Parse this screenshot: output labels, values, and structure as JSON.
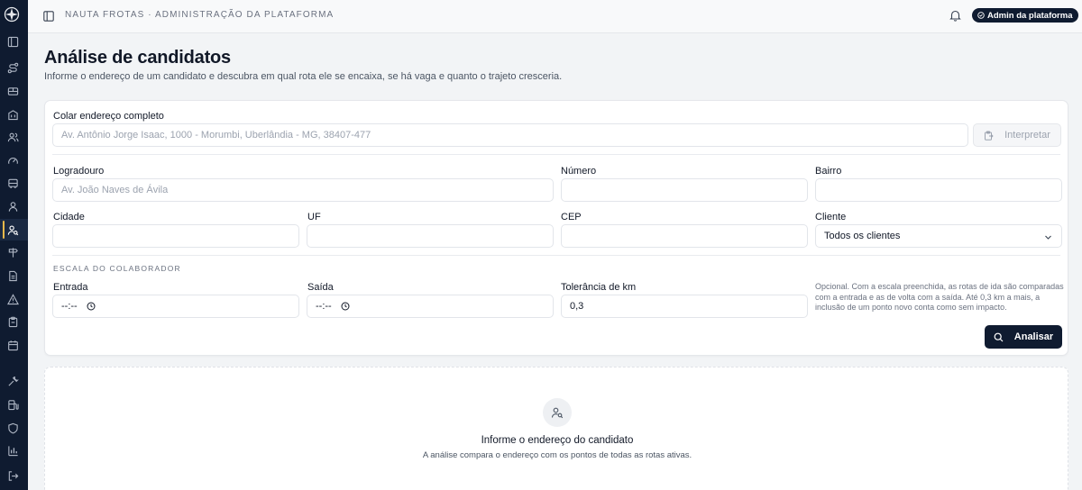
{
  "app": {
    "breadcrumb": "NAUTA FROTAS · ADMINISTRAÇÃO DA PLATAFORMA",
    "role_badge": "Admin da plataforma"
  },
  "sidebar": {
    "items": [
      {
        "icon": "panel-icon"
      },
      {
        "icon": "route-icon"
      },
      {
        "icon": "bus-icon"
      },
      {
        "icon": "building-icon"
      },
      {
        "icon": "users-icon"
      },
      {
        "icon": "gauge-icon"
      },
      {
        "icon": "vehicle-icon"
      },
      {
        "icon": "user-icon"
      },
      {
        "icon": "user-search-icon",
        "active": true
      },
      {
        "icon": "signpost-icon"
      },
      {
        "icon": "document-icon"
      },
      {
        "icon": "alert-icon"
      },
      {
        "icon": "clipboard-icon"
      },
      {
        "icon": "calendar-icon"
      },
      {
        "icon": "wrench-icon"
      },
      {
        "icon": "fuel-icon"
      },
      {
        "icon": "shield-icon"
      },
      {
        "icon": "chart-icon"
      },
      {
        "icon": "logout-icon"
      }
    ],
    "accent": "#e8b84a"
  },
  "header": {
    "title": "Análise de candidatos",
    "subtitle": "Informe o endereço de um candidato e descubra em qual rota ele se encaixa, se há vaga e quanto o trajeto cresceria."
  },
  "form": {
    "paste_label": "Colar endereço completo",
    "paste_placeholder": "Av. Antônio Jorge Isaac, 1000 - Morumbi, Uberlândia - MG, 38407-477",
    "interpret_label": "Interpretar",
    "street_label": "Logradouro",
    "street_placeholder": "Av. João Naves de Ávila",
    "number_label": "Número",
    "number_value": "",
    "district_label": "Bairro",
    "district_value": "",
    "city_label": "Cidade",
    "city_value": "",
    "state_label": "UF",
    "state_value": "",
    "zip_label": "CEP",
    "zip_value": "",
    "client_label": "Cliente",
    "client_value": "Todos os clientes",
    "schedule_section": "ESCALA DO COLABORADOR",
    "entry_label": "Entrada",
    "entry_value": "--:--",
    "exit_label": "Saída",
    "exit_value": "--:--",
    "tolerance_label": "Tolerância de km",
    "tolerance_value": "0,3",
    "help_text": "Opcional. Com a escala preenchida, as rotas de ida são comparadas com a entrada e as de volta com a saída. Até 0,3 km a mais, a inclusão de um ponto novo conta como sem impacto.",
    "analyze_label": "Analisar"
  },
  "empty_state": {
    "title": "Informe o endereço do candidato",
    "subtitle": "A análise compara o endereço com os pontos de todas as rotas ativas."
  },
  "colors": {
    "navy": "#0f1b30",
    "background": "#f2f4f6"
  }
}
